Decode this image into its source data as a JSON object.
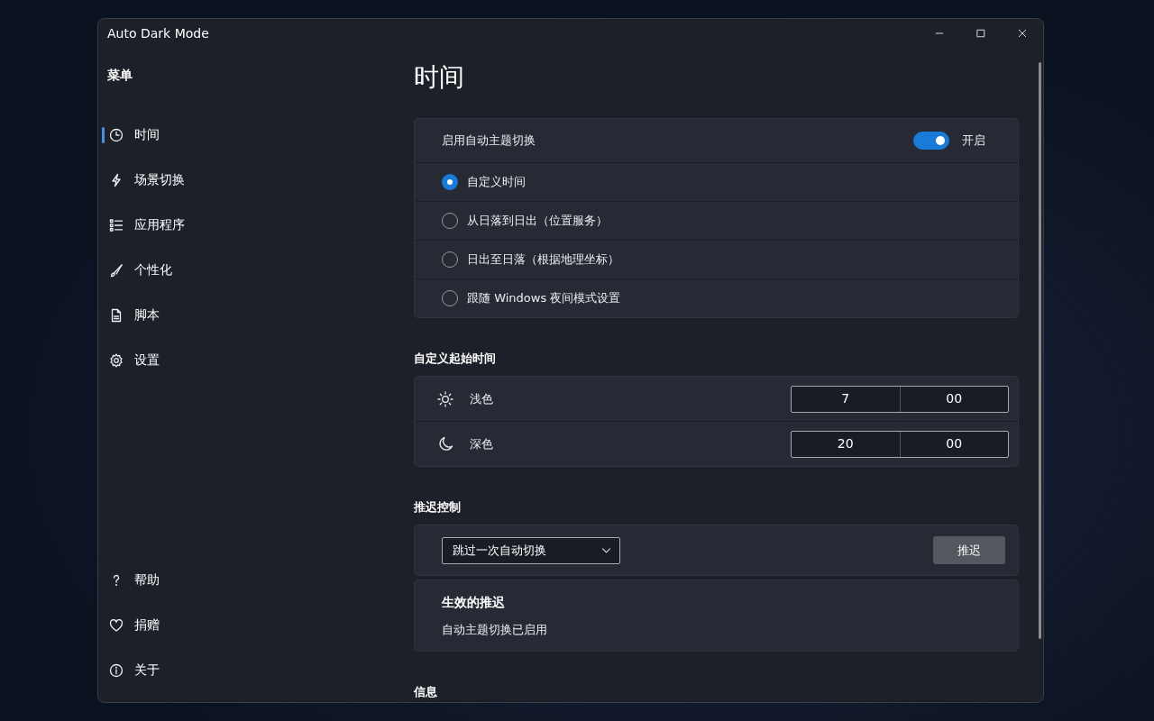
{
  "window": {
    "title": "Auto Dark Mode"
  },
  "sidebar": {
    "header": "菜单",
    "items": [
      {
        "label": "时间",
        "selected": true
      },
      {
        "label": "场景切换",
        "selected": false
      },
      {
        "label": "应用程序",
        "selected": false
      },
      {
        "label": "个性化",
        "selected": false
      },
      {
        "label": "脚本",
        "selected": false
      },
      {
        "label": "设置",
        "selected": false
      }
    ],
    "footer_items": [
      {
        "label": "帮助"
      },
      {
        "label": "捐赠"
      },
      {
        "label": "关于"
      }
    ]
  },
  "page": {
    "title": "时间",
    "auto_switch": {
      "label": "启用自动主题切换",
      "on": true,
      "state_text": "开启"
    },
    "modes": [
      {
        "label": "自定义时间",
        "selected": true
      },
      {
        "label": "从日落到日出（位置服务）",
        "selected": false
      },
      {
        "label": "日出至日落（根据地理坐标）",
        "selected": false
      },
      {
        "label": "跟随 Windows 夜间模式设置",
        "selected": false
      }
    ],
    "custom_start": {
      "heading": "自定义起始时间",
      "rows": [
        {
          "label": "浅色",
          "hour": "7",
          "minute": "00"
        },
        {
          "label": "深色",
          "hour": "20",
          "minute": "00"
        }
      ]
    },
    "postpone": {
      "heading": "推迟控制",
      "dropdown": "跳过一次自动切换",
      "button": "推迟",
      "active_title": "生效的推迟",
      "active_text": "自动主题切换已启用"
    },
    "info": {
      "heading": "信息"
    }
  }
}
